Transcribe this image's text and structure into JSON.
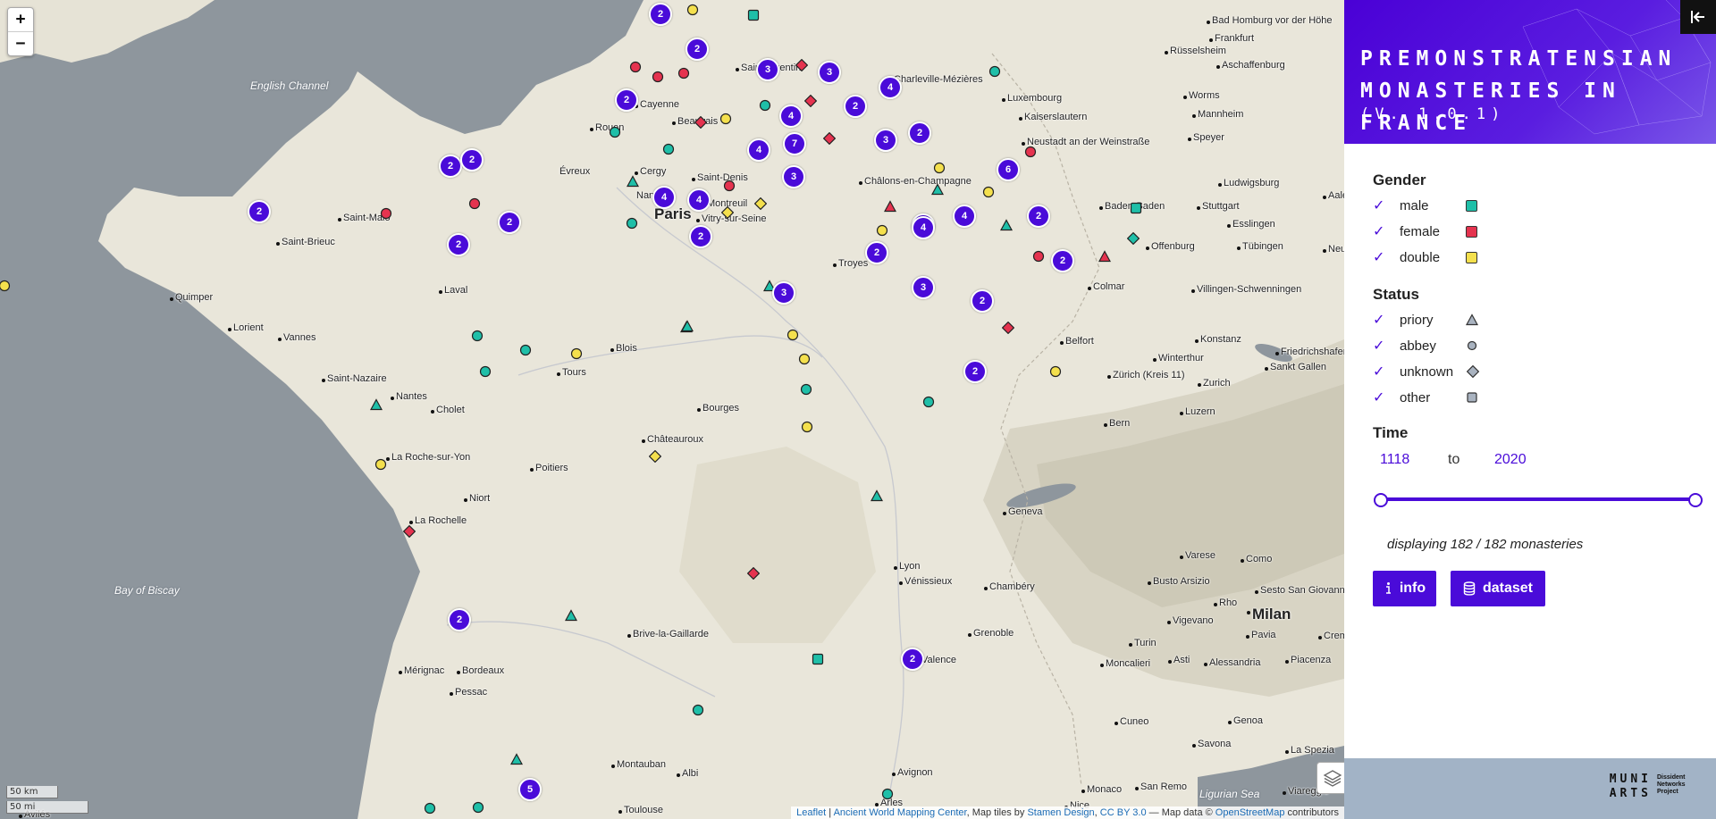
{
  "map": {
    "zoom_in": "+",
    "zoom_out": "−",
    "scale_km": "50 km",
    "scale_mi": "50 mi",
    "attribution": {
      "leaflet": "Leaflet",
      "awmc": "Ancient World Mapping Center",
      "tiles_prefix": ", Map tiles by",
      "stamen": "Stamen Design",
      "cc": "CC BY 3.0",
      "data_prefix": "— Map data ©",
      "osm": "OpenStreetMap",
      "contributors": "contributors"
    },
    "seas": [
      "English Channel",
      "Bay of Biscay",
      "Ligurian Sea"
    ],
    "cities": [
      "Paris",
      "Saint-Quentin",
      "Cayenne",
      "Beauvais",
      "Rouen",
      "Évreux",
      "Cergy",
      "Nanterre",
      "Saint-Denis",
      "Montreuil",
      "Vitry-sur-Seine",
      "Charleville-Mézières",
      "Châlons-en-Champagne",
      "Troyes",
      "Saint-Malo",
      "Saint-Brieuc",
      "Quimper",
      "Lorient",
      "Vannes",
      "Laval",
      "Saint-Nazaire",
      "Nantes",
      "Cholet",
      "Tours",
      "Blois",
      "Bourges",
      "Châteauroux",
      "La Roche-sur-Yon",
      "Poitiers",
      "Niort",
      "La Rochelle",
      "Brive-la-Gaillarde",
      "Mérignac",
      "Bordeaux",
      "Pessac",
      "Montauban",
      "Albi",
      "Toulouse",
      "Avilés",
      "Lyon",
      "Vénissieux",
      "Chambéry",
      "Grenoble",
      "Valence",
      "Avignon",
      "Arles",
      "Luxembourg",
      "Kaiserslautern",
      "Neustadt an der Weinstraße",
      "Colmar",
      "Belfort",
      "Baden-Baden",
      "Offenburg",
      "Stuttgart",
      "Esslingen",
      "Tübingen",
      "Ludwigsburg",
      "Villingen-Schwenningen",
      "Konstanz",
      "Winterthur",
      "Zürich (Kreis 11)",
      "Zurich",
      "Friedrichshafen",
      "Sankt Gallen",
      "Luzern",
      "Bern",
      "Geneva",
      "Varese",
      "Como",
      "Busto Arsizio",
      "Rho",
      "Milan",
      "Sesto San Giovanni",
      "Vigevano",
      "Pavia",
      "Turin",
      "Moncalieri",
      "Asti",
      "Alessandria",
      "Piacenza",
      "Cuneo",
      "Genoa",
      "Savona",
      "Monaco",
      "San Remo",
      "Nice",
      "La Spezia",
      "Viareggio",
      "Bad Homburg vor der Höhe",
      "Frankfurt",
      "Rüsselsheim",
      "Aschaffenburg",
      "Worms",
      "Mannheim",
      "Speyer",
      "Aalen",
      "Neu-Ulm",
      "Cremona"
    ],
    "clusters": [
      "2",
      "2",
      "3",
      "3",
      "4",
      "2",
      "2",
      "4",
      "7",
      "3",
      "3",
      "2",
      "4",
      "6",
      "2",
      "4",
      "4",
      "2",
      "2",
      "3",
      "2",
      "2",
      "2",
      "2",
      "2",
      "3",
      "4",
      "4",
      "2",
      "2",
      "4",
      "2",
      "2",
      "2",
      "5"
    ]
  },
  "legend_colors": {
    "male": "#1fbfa8",
    "female": "#e5334f",
    "double": "#f4e04d",
    "cluster": "#4a0bd9"
  },
  "panel": {
    "title_line1": "PREMONSTRATENSIAN",
    "title_line2": "MONASTERIES IN FRANCE",
    "version": "(V. 1.0.1)",
    "gender_heading": "Gender",
    "gender": [
      {
        "label": "male",
        "color": "#1fbfa8"
      },
      {
        "label": "female",
        "color": "#e5334f"
      },
      {
        "label": "double",
        "color": "#f4e04d"
      }
    ],
    "status_heading": "Status",
    "status": [
      {
        "label": "priory",
        "icon": "triangle-icon"
      },
      {
        "label": "abbey",
        "icon": "circle-icon"
      },
      {
        "label": "unknown",
        "icon": "diamond-icon"
      },
      {
        "label": "other",
        "icon": "square-icon"
      }
    ],
    "time_heading": "Time",
    "time_from": "1118",
    "time_to_label": "to",
    "time_to": "2020",
    "summary": "displaying 182 / 182 monasteries",
    "info_button": "info",
    "dataset_button": "dataset",
    "logo_line1": "MUNI",
    "logo_line2": "ARTS",
    "logo_caption": "Dissident Networks Project"
  }
}
